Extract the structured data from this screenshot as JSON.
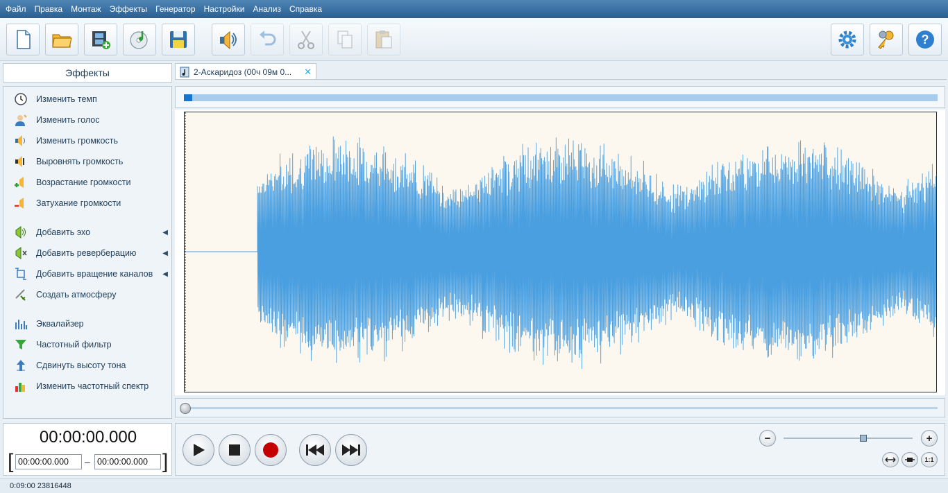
{
  "menu": [
    "Файл",
    "Правка",
    "Монтаж",
    "Эффекты",
    "Генератор",
    "Настройки",
    "Анализ",
    "Справка"
  ],
  "effects_panel": {
    "title": "Эффекты",
    "items": [
      {
        "label": "Изменить темп",
        "icon": "clock-icon"
      },
      {
        "label": "Изменить голос",
        "icon": "voice-icon"
      },
      {
        "label": "Изменить громкость",
        "icon": "volume-icon"
      },
      {
        "label": "Выровнять громкость",
        "icon": "volume-level-icon"
      },
      {
        "label": "Возрастание громкости",
        "icon": "fade-in-icon"
      },
      {
        "label": "Затухание громкости",
        "icon": "fade-out-icon"
      },
      {
        "label": "Добавить эхо",
        "icon": "echo-icon"
      },
      {
        "label": "Добавить реверберацию",
        "icon": "reverb-icon"
      },
      {
        "label": "Добавить вращение каналов",
        "icon": "rotate-channels-icon"
      },
      {
        "label": "Создать атмосферу",
        "icon": "atmosphere-icon"
      },
      {
        "label": "Эквалайзер",
        "icon": "equalizer-icon"
      },
      {
        "label": "Частотный фильтр",
        "icon": "filter-icon"
      },
      {
        "label": "Сдвинуть высоту тона",
        "icon": "pitch-icon"
      },
      {
        "label": "Изменить частотный спектр",
        "icon": "spectrum-icon"
      }
    ]
  },
  "tab": {
    "title": "2-Аскаридоз (00ч 09м 0...",
    "close": "✕"
  },
  "time": {
    "current": "00:00:00.000",
    "start": "00:00:00.000",
    "end": "00:00:00.000",
    "dash": "–",
    "bracket_left": "[",
    "bracket_right": "]"
  },
  "zoom": {
    "minus": "−",
    "plus": "+",
    "fit": "1:1",
    "level": 0.62
  },
  "playback": {
    "position": 0,
    "overview_position": 0
  },
  "status": {
    "text": "0:09:00 23816448"
  },
  "colors": {
    "menubar": "#3b72a5",
    "waveform": "#4a9fe0",
    "wave_bg": "#fdf8ef",
    "record": "#c40000"
  }
}
